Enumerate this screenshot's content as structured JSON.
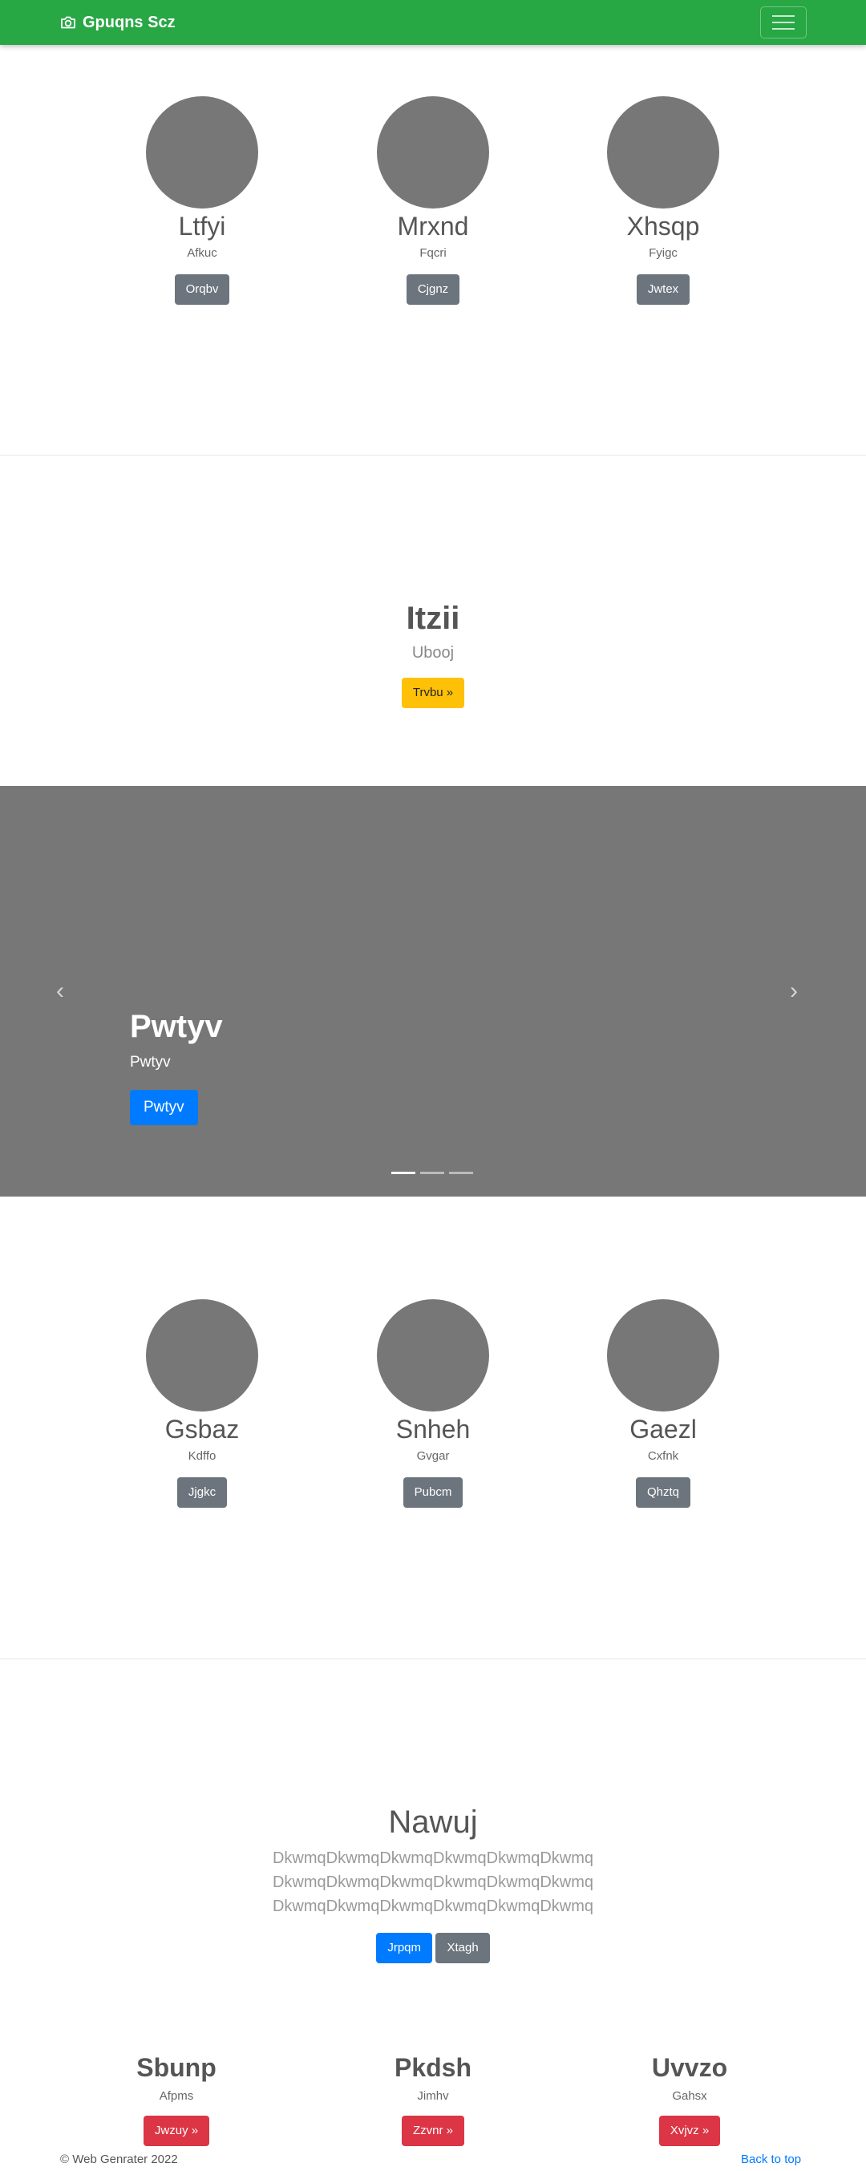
{
  "navbar": {
    "brand": "Gpuqns Scz",
    "brand_icon": "camera-icon",
    "toggler_icon": "hamburger-icon",
    "color": "#28a745"
  },
  "profiles_top": [
    {
      "name": "Ltfyi",
      "subtitle": "Afkuc",
      "button": "Orqbv"
    },
    {
      "name": "Mrxnd",
      "subtitle": "Fqcri",
      "button": "Cjgnz"
    },
    {
      "name": "Xhsqp",
      "subtitle": "Fyigc",
      "button": "Jwtex"
    }
  ],
  "feature": {
    "title": "Itzii",
    "subtitle": "Ubooj",
    "button": "Trvbu »"
  },
  "carousel": {
    "title": "Pwtyv",
    "text": "Pwtyv",
    "button": "Pwtyv",
    "prev_icon": "chevron-left-icon",
    "next_icon": "chevron-right-icon",
    "slide_count": 3,
    "active_slide": 1
  },
  "profiles_bottom": [
    {
      "name": "Gsbaz",
      "subtitle": "Kdffo",
      "button": "Jjgkc"
    },
    {
      "name": "Snheh",
      "subtitle": "Gvgar",
      "button": "Pubcm"
    },
    {
      "name": "Gaezl",
      "subtitle": "Cxfnk",
      "button": "Qhztq"
    }
  ],
  "lorem": {
    "title": "Nawuj",
    "lines": [
      "DkwmqDkwmqDkwmqDkwmqDkwmqDkwmq",
      "DkwmqDkwmqDkwmqDkwmqDkwmqDkwmq",
      "DkwmqDkwmqDkwmqDkwmqDkwmqDkwmq"
    ],
    "primary_button": "Jrpqm",
    "secondary_button": "Xtagh"
  },
  "columns": [
    {
      "title": "Sbunp",
      "subtitle": "Afpms",
      "button": "Jwzuy »"
    },
    {
      "title": "Pkdsh",
      "subtitle": "Jimhv",
      "button": "Zzvnr »"
    },
    {
      "title": "Uvvzo",
      "subtitle": "Gahsx",
      "button": "Xvjvz »"
    }
  ],
  "footer": {
    "copyright": "© Web Genrater 2022",
    "back_to_top": "Back to top"
  }
}
